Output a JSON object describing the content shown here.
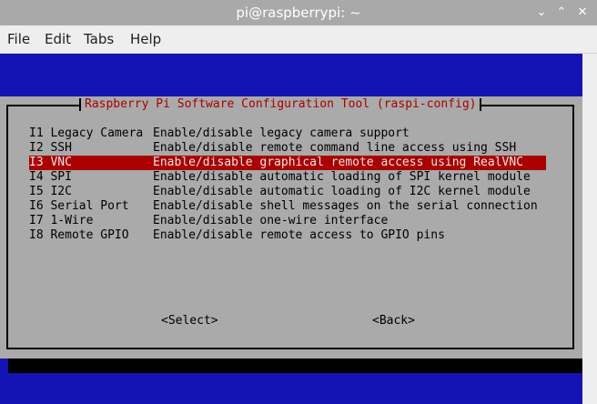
{
  "window": {
    "title": "pi@raspberrypi: ~",
    "controls": {
      "minimize": "⌄",
      "maximize": "⌃",
      "close": "✕"
    }
  },
  "menubar": {
    "items": [
      "File",
      "Edit",
      "Tabs",
      "Help"
    ]
  },
  "dialog": {
    "title": "Raspberry Pi Software Configuration Tool (raspi-config)",
    "options": [
      {
        "tag": "I1 Legacy Camera",
        "description": "Enable/disable legacy camera support",
        "selected": false
      },
      {
        "tag": "I2 SSH",
        "description": "Enable/disable remote command line access using SSH",
        "selected": false
      },
      {
        "tag": "I3 VNC",
        "description": "Enable/disable graphical remote access using RealVNC",
        "selected": true
      },
      {
        "tag": "I4 SPI",
        "description": "Enable/disable automatic loading of SPI kernel module",
        "selected": false
      },
      {
        "tag": "I5 I2C",
        "description": "Enable/disable automatic loading of I2C kernel module",
        "selected": false
      },
      {
        "tag": "I6 Serial Port",
        "description": "Enable/disable shell messages on the serial connection",
        "selected": false
      },
      {
        "tag": "I7 1-Wire",
        "description": "Enable/disable one-wire interface",
        "selected": false
      },
      {
        "tag": "I8 Remote GPIO",
        "description": "Enable/disable remote access to GPIO pins",
        "selected": false
      }
    ],
    "buttons": {
      "select": "<Select>",
      "back": "<Back>"
    }
  },
  "colors": {
    "terminal_blue": "#1414b4",
    "dialog_gray": "#aaaaaa",
    "selection_red": "#aa0000",
    "title_red": "#aa0000"
  }
}
